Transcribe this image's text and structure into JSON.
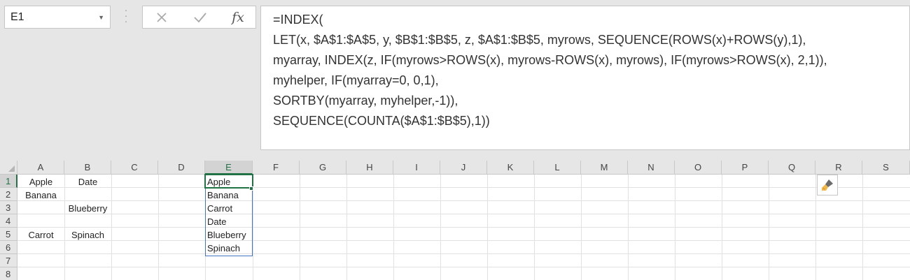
{
  "name_box": {
    "value": "E1"
  },
  "formula_bar": {
    "cancel_icon": "close-icon",
    "enter_icon": "check-icon",
    "fx_label": "fx",
    "lines": [
      "=INDEX(",
      "LET(x, $A$1:$A$5, y, $B$1:$B$5, z, $A$1:$B$5, myrows, SEQUENCE(ROWS(x)+ROWS(y),1),",
      "myarray, INDEX(z, IF(myrows>ROWS(x), myrows-ROWS(x), myrows), IF(myrows>ROWS(x), 2,1)),",
      "myhelper, IF(myarray=0, 0,1),",
      "SORTBY(myarray, myhelper,-1)),",
      "SEQUENCE(COUNTA($A$1:$B$5),1))"
    ]
  },
  "columns": [
    "A",
    "B",
    "C",
    "D",
    "E",
    "F",
    "G",
    "H",
    "I",
    "J",
    "K",
    "L",
    "M",
    "N",
    "O",
    "P",
    "Q",
    "R",
    "S"
  ],
  "rows": [
    "1",
    "2",
    "3",
    "4",
    "5",
    "6",
    "7",
    "8"
  ],
  "cells": {
    "A1": "Apple",
    "B1": "Date",
    "A2": "Banana",
    "B3": "Blueberry",
    "A5": "Carrot",
    "B5": "Spinach",
    "E1": "Apple",
    "E2": "Banana",
    "E3": "Carrot",
    "E4": "Date",
    "E5": "Blueberry",
    "E6": "Spinach"
  },
  "selection": {
    "active_cell": "E1",
    "spill_range": "E1:E6"
  },
  "colors": {
    "accent": "#217346",
    "spill_border": "#4472c4"
  }
}
